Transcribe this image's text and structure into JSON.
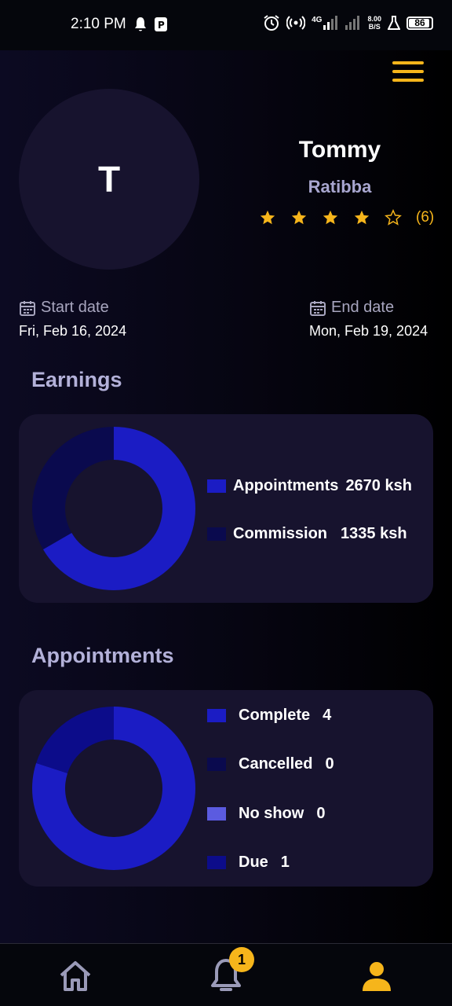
{
  "status_bar": {
    "time": "2:10 PM",
    "net_speed_top": "8.00",
    "net_speed_bottom": "B/S",
    "signal_label": "4G",
    "battery": "86",
    "icons": [
      "bell-icon",
      "app-icon",
      "alarm-icon",
      "hotspot-icon",
      "signal-icon",
      "flask-icon",
      "battery-icon"
    ]
  },
  "profile": {
    "initial": "T",
    "name": "Tommy",
    "business": "Ratibba",
    "rating_stars": 4,
    "rating_max": 5,
    "rating_count": "(6)",
    "star_color": "#f6b51b"
  },
  "dates": {
    "start_label": "Start date",
    "start_value": "Fri, Feb 16, 2024",
    "end_label": "End date",
    "end_value": "Mon, Feb 19, 2024"
  },
  "earnings": {
    "title": "Earnings",
    "legend": [
      {
        "label": "Appointments",
        "value": "2670 ksh",
        "color": "#1b1cc4"
      },
      {
        "label": "Commission",
        "value": "1335 ksh",
        "color": "#0a0a4e"
      }
    ]
  },
  "appointments": {
    "title": "Appointments",
    "legend": [
      {
        "label": "Complete",
        "value": "4",
        "color": "#1b1cc4"
      },
      {
        "label": "Cancelled",
        "value": "0",
        "color": "#0a0a4e"
      },
      {
        "label": "No show",
        "value": "0",
        "color": "#5b5be0"
      },
      {
        "label": "Due",
        "value": "1",
        "color": "#0c0c8a"
      }
    ]
  },
  "nav": {
    "items": [
      "home-icon",
      "notifications-icon",
      "profile-icon"
    ],
    "notification_count": "1",
    "active_color": "#f6b51b",
    "inactive_color": "#9a9ab8"
  },
  "chart_data": [
    {
      "type": "pie",
      "categories": [
        "Appointments",
        "Commission"
      ],
      "values": [
        2670,
        1335
      ]
    },
    {
      "type": "pie",
      "categories": [
        "Complete",
        "Cancelled",
        "No show",
        "Due"
      ],
      "values": [
        4,
        0,
        0,
        1
      ]
    }
  ]
}
